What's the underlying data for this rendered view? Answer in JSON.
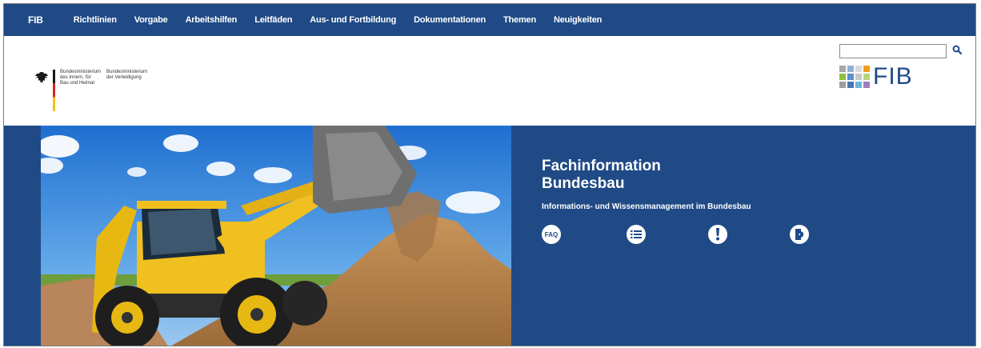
{
  "topnav": {
    "home": "FIB",
    "items": [
      "Richtlinien",
      "Vorgabe",
      "Arbeitshilfen",
      "Leitfäden",
      "Aus- und Fortbildung",
      "Dokumentationen",
      "Themen",
      "Neuigkeiten"
    ]
  },
  "header": {
    "ministry1": "Bundesministerium des Innern, für Bau und Heimat",
    "ministry2": "Bundesministerium der Verteidigung",
    "search_value": "",
    "logo_text": "FIB",
    "logo_colors": [
      "#a6a6a6",
      "#8fb0d3",
      "#d9d9d9",
      "#f39a1e",
      "#8dc040",
      "#5b8fc9",
      "#c9c9c9",
      "#b7d47f",
      "#9e9e9e",
      "#4a77b4",
      "#6fb5d6",
      "#a07bc0"
    ]
  },
  "hero": {
    "title": "Fachinformation Bundesbau",
    "subtitle": "Informations- und Wissensmanagement im Bundesbau",
    "icons": [
      "faq-icon",
      "list-icon",
      "exclamation-icon",
      "door-icon"
    ],
    "faq_label": "FAQ"
  },
  "colors": {
    "brand_blue": "#1f4a86"
  }
}
